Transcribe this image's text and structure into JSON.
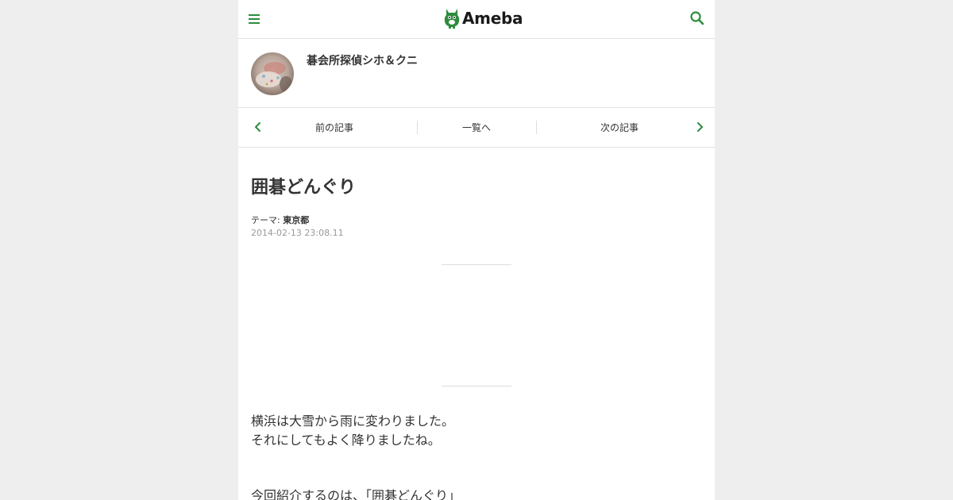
{
  "header": {
    "logo_text": "Ameba",
    "menu_icon": "hamburger-menu-icon",
    "search_icon": "search-icon",
    "accent_color": "#2d8c3c"
  },
  "profile": {
    "blog_title": "碁会所探偵シホ＆クニ",
    "avatar_icon": "avatar-image"
  },
  "pager": {
    "prev_label": "前の記事",
    "list_label": "一覧へ",
    "next_label": "次の記事"
  },
  "article": {
    "title": "囲碁どんぐり",
    "theme_prefix": "テーマ:",
    "theme_name": "東京都",
    "date": "2014-02-13 23:08.11",
    "paragraphs": [
      "横浜は大雪から雨に変わりました。",
      "それにしてもよく降りましたね。",
      "今回紹介するのは、「囲碁どんぐり」"
    ]
  }
}
